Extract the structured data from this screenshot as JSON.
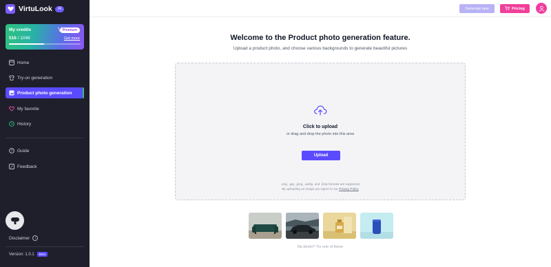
{
  "brand": {
    "name": "VirtuLook",
    "badge": "AI"
  },
  "credits": {
    "title": "My credits",
    "premium": "Premium",
    "used": "516",
    "total": "1048",
    "separator": " / ",
    "invite": "Get more",
    "progress": 0.49
  },
  "nav": {
    "home": "Home",
    "tryon": "Try-on generation",
    "product": "Product photo generation",
    "favorite": "My favorite",
    "history": "History",
    "guide": "Guide",
    "feedback": "Feedback"
  },
  "footer": {
    "disclaimer": "Disclaimer",
    "version": "Version: 1.0.1",
    "beta": "Beta"
  },
  "topbar": {
    "generate": "Generate new",
    "pricing": "Pricing"
  },
  "main": {
    "title": "Welcome to the Product photo generation feature.",
    "subtitle": "Upload a product photo, and choose various backgrounds to generate beautiful pictures",
    "click_upload": "Click to upload",
    "drag_text": "or drag and drop the photo into this area",
    "upload_button": "Upload",
    "formats": ".png, .jpg, .jpeg, .webp, and .bmp formats are supported",
    "consent_prefix": "By uploading an image you agree to our ",
    "consent_link": "Privacy Policy",
    "try_text": "No photo? Try one of these"
  },
  "colors": {
    "accent": "#5b4bff",
    "pricing": "#f0409a",
    "sidebar": "#1e1f2a"
  },
  "icons": [
    "home-icon",
    "shirt-icon",
    "image-icon",
    "heart-icon",
    "history-icon",
    "help-icon",
    "feedback-icon",
    "upload-cloud-icon",
    "cart-icon",
    "user-icon"
  ]
}
